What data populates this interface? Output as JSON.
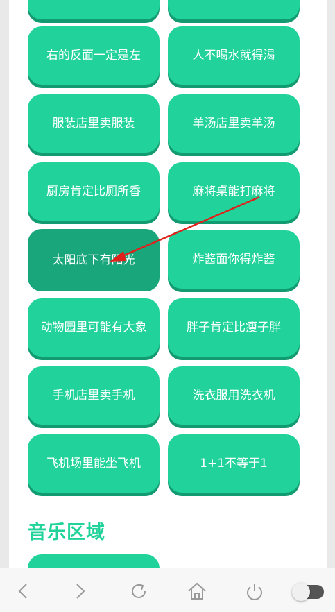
{
  "phrases": [
    "右的反面一定是左",
    "人不喝水就得渴",
    "服装店里卖服装",
    "羊汤店里卖羊汤",
    "厨房肯定比厕所香",
    "麻将桌能打麻将",
    "太阳底下有阳光",
    "炸酱面你得炸酱",
    "动物园里可能有大象",
    "胖子肯定比瘦子胖",
    "手机店里卖手机",
    "洗衣服用洗衣机",
    "飞机场里能坐飞机",
    "1+1不等于1"
  ],
  "section_title": "音乐区域",
  "pressed_button_index": 6,
  "colors": {
    "button": "#21d39a",
    "button_shadow": "#129a70",
    "button_pressed": "#1aa67b",
    "title": "#21d39a",
    "annotation_arrow": "#e0201b"
  },
  "nav": {
    "icons": [
      "back-icon",
      "forward-icon",
      "refresh-icon",
      "home-icon",
      "power-icon",
      "toggle-switch"
    ],
    "toggle_on": false
  }
}
